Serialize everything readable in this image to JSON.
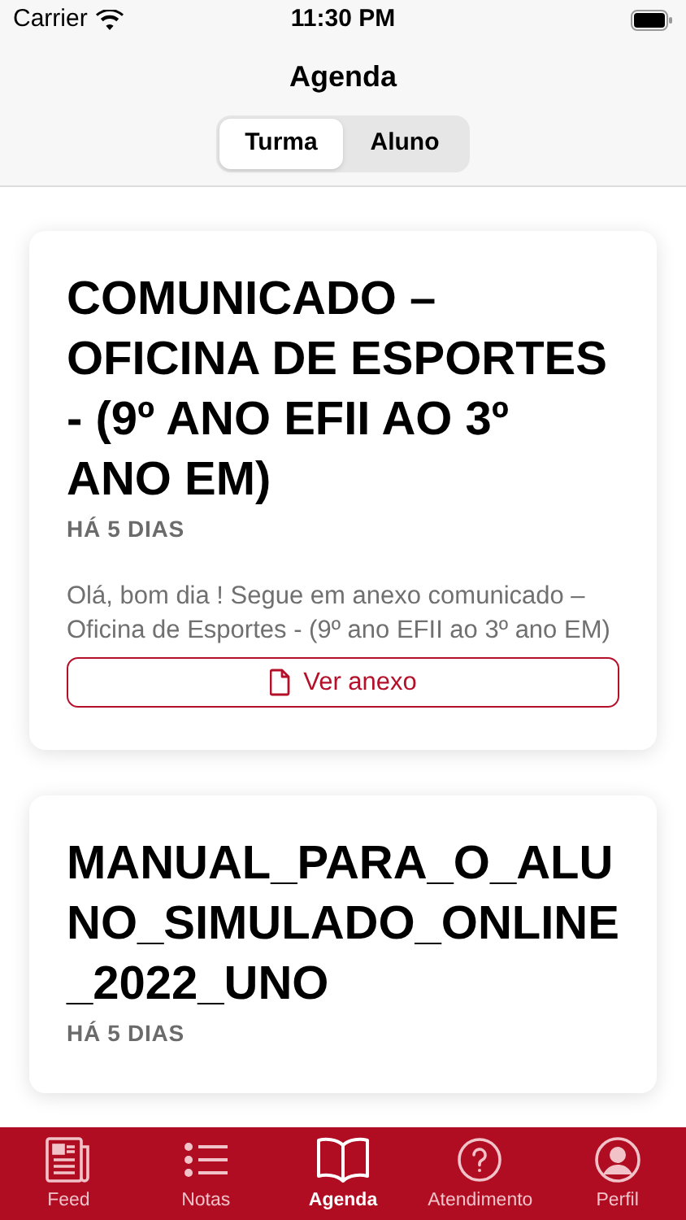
{
  "status_bar": {
    "carrier": "Carrier",
    "time": "11:30 PM"
  },
  "title": "Agenda",
  "segments": [
    {
      "label": "Turma",
      "selected": true
    },
    {
      "label": "Aluno",
      "selected": false
    }
  ],
  "posts": [
    {
      "title": "COMUNICADO – OFICINA DE ESPORTES - (9º ANO EFII AO 3º ANO EM)",
      "age": "HÁ 5 DIAS",
      "body": "Olá, bom dia !  Segue em anexo comunicado – Oficina de Esportes - (9º ano EFII ao 3º ano EM)",
      "attachment": "Ver anexo"
    },
    {
      "title": "MANUAL_PARA_O_ALUNO_SIMULADO_ONLINE_2022_UNO",
      "age": "HÁ 5 DIAS"
    }
  ],
  "tab_bar": [
    {
      "label": "Feed",
      "kind": "news",
      "selected": false
    },
    {
      "label": "Notas",
      "kind": "list",
      "selected": false
    },
    {
      "label": "Agenda",
      "kind": "book",
      "selected": true
    },
    {
      "label": "Atendimento",
      "kind": "help",
      "selected": false
    },
    {
      "label": "Perfil",
      "kind": "profile",
      "selected": false
    }
  ]
}
